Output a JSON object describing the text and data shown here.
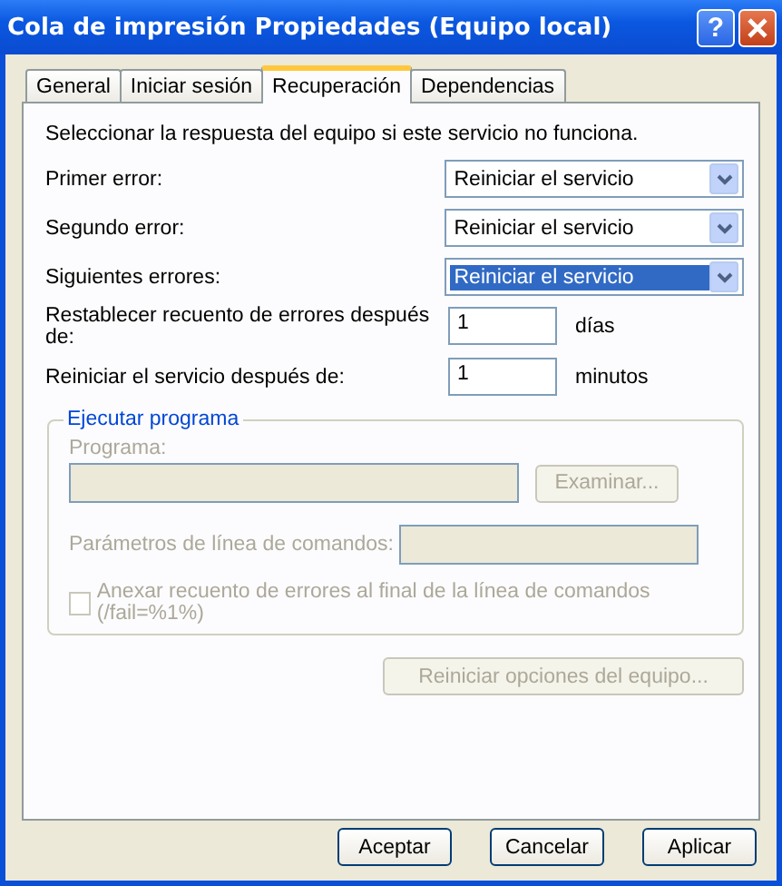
{
  "window": {
    "title": "Cola de impresión Propiedades (Equipo local)",
    "help_button": "?"
  },
  "tabs": [
    {
      "label": "General",
      "selected": false
    },
    {
      "label": "Iniciar sesión",
      "selected": false
    },
    {
      "label": "Recuperación",
      "selected": true
    },
    {
      "label": "Dependencias",
      "selected": false
    }
  ],
  "description": "Seleccionar la respuesta del equipo si este servicio no funciona.",
  "failure_actions": [
    {
      "label": "Primer error:",
      "value": "Reiniciar el servicio",
      "focused": false
    },
    {
      "label": "Segundo error:",
      "value": "Reiniciar el servicio",
      "focused": false
    },
    {
      "label": "Siguientes errores:",
      "value": "Reiniciar el servicio",
      "focused": true
    }
  ],
  "counters": [
    {
      "label": "Restablecer recuento de errores después de:",
      "value": "1",
      "unit": "días"
    },
    {
      "label": "Reiniciar el servicio después de:",
      "value": "1",
      "unit": "minutos"
    }
  ],
  "run_program": {
    "title": "Ejecutar programa",
    "disabled": true,
    "program_label": "Programa:",
    "browse_button": "Examinar...",
    "params_label": "Parámetros de línea de comandos:",
    "append_checkbox": {
      "label": "Anexar recuento de errores al final de la línea de comandos (/fail=%1%)",
      "checked": false
    }
  },
  "restart_options_button": {
    "label": "Reiniciar opciones del equipo...",
    "disabled": true
  },
  "buttons": [
    "Aceptar",
    "Cancelar",
    "Aplicar"
  ]
}
